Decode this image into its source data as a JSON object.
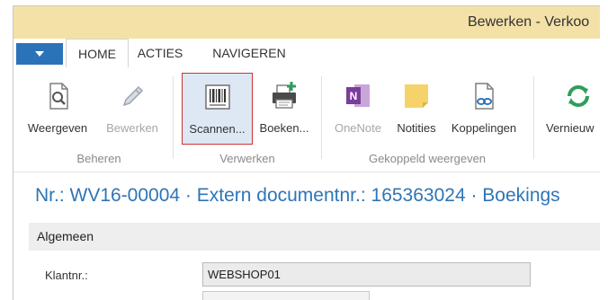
{
  "window": {
    "title": "Bewerken - Verkoo"
  },
  "tabs": [
    {
      "label": "HOME",
      "active": true
    },
    {
      "label": "ACTIES",
      "active": false
    },
    {
      "label": "NAVIGEREN",
      "active": false
    }
  ],
  "ribbon": {
    "groups": [
      {
        "label": "Beheren",
        "buttons": [
          {
            "label": "Weergeven",
            "icon": "view-document-icon",
            "enabled": true
          },
          {
            "label": "Bewerken",
            "icon": "pencil-icon",
            "enabled": false
          }
        ]
      },
      {
        "label": "Verwerken",
        "buttons": [
          {
            "label": "Scannen...",
            "icon": "barcode-icon",
            "enabled": true,
            "selected": true
          },
          {
            "label": "Boeken...",
            "icon": "post-printer-icon",
            "enabled": true
          }
        ]
      },
      {
        "label": "Gekoppeld weergeven",
        "buttons": [
          {
            "label": "OneNote",
            "icon": "onenote-icon",
            "enabled": false
          },
          {
            "label": "Notities",
            "icon": "note-icon",
            "enabled": true
          },
          {
            "label": "Koppelingen",
            "icon": "link-document-icon",
            "enabled": true
          }
        ]
      },
      {
        "label": "",
        "buttons": [
          {
            "label": "Vernieuw",
            "icon": "refresh-icon",
            "enabled": true
          }
        ]
      }
    ]
  },
  "page": {
    "title": "Nr.: WV16-00004 · Extern documentnr.: 165363024 · Boekings"
  },
  "section": {
    "title": "Algemeen",
    "fields": [
      {
        "label": "Klantnr.:",
        "value": "WEBSHOP01"
      }
    ]
  },
  "colors": {
    "title_bar": "#f3e1a8",
    "file_button": "#2b73b8",
    "page_title": "#2e75b6",
    "selection_border": "#cc3333",
    "refresh_green": "#2f9e5a",
    "onenote_purple": "#7a3d9b",
    "note_yellow": "#f5d36a"
  }
}
